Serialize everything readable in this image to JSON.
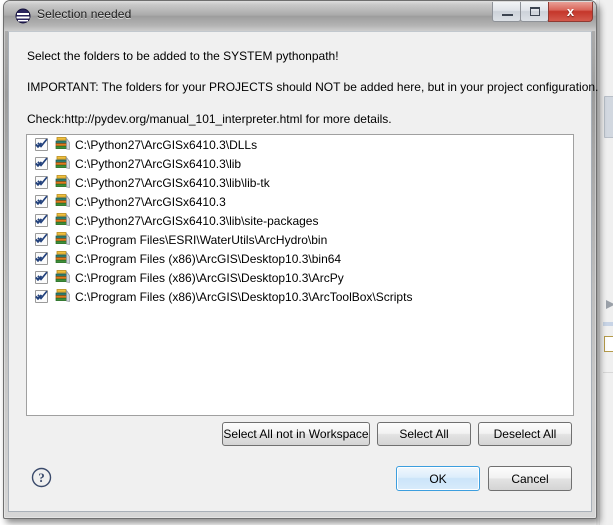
{
  "window": {
    "title": "Selection needed",
    "icon": "eclipse-pydev-icon",
    "controls": {
      "minimize_label": "",
      "maximize_label": "",
      "close_label": "x"
    }
  },
  "messages": {
    "line1": "Select the folders to be added to the SYSTEM pythonpath!",
    "line2": "IMPORTANT: The folders for your PROJECTS should NOT be added here, but in your project configuration.",
    "line3": "Check:http://pydev.org/manual_101_interpreter.html for more details."
  },
  "folder_list": {
    "items": [
      {
        "path": "C:\\Python27\\ArcGISx6410.3\\DLLs",
        "checked": true
      },
      {
        "path": "C:\\Python27\\ArcGISx6410.3\\lib",
        "checked": true
      },
      {
        "path": "C:\\Python27\\ArcGISx6410.3\\lib\\lib-tk",
        "checked": true
      },
      {
        "path": "C:\\Python27\\ArcGISx6410.3",
        "checked": true
      },
      {
        "path": "C:\\Python27\\ArcGISx6410.3\\lib\\site-packages",
        "checked": true
      },
      {
        "path": "C:\\Program Files\\ESRI\\WaterUtils\\ArcHydro\\bin",
        "checked": true
      },
      {
        "path": "C:\\Program Files (x86)\\ArcGIS\\Desktop10.3\\bin64",
        "checked": true
      },
      {
        "path": "C:\\Program Files (x86)\\ArcGIS\\Desktop10.3\\ArcPy",
        "checked": true
      },
      {
        "path": "C:\\Program Files (x86)\\ArcGIS\\Desktop10.3\\ArcToolBox\\Scripts",
        "checked": true
      }
    ]
  },
  "selection_buttons": {
    "select_all_not_in_workspace": "Select All not in Workspace",
    "select_all": "Select All",
    "deselect_all": "Deselect All"
  },
  "dialog_buttons": {
    "ok": "OK",
    "cancel": "Cancel",
    "help_icon": "help-question-icon"
  },
  "colors": {
    "dialog_background": "#f0f0f0",
    "list_background": "#ffffff",
    "default_button_border": "#3c9ede",
    "close_button": "#c4362a",
    "checkmark": "#22417c"
  }
}
